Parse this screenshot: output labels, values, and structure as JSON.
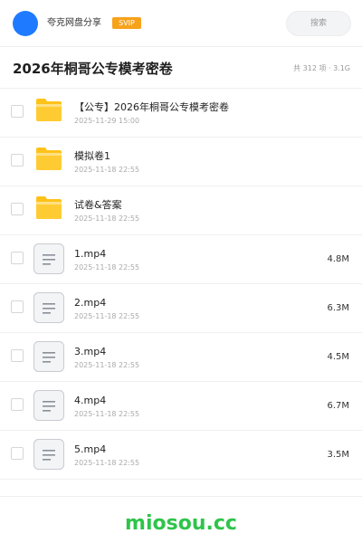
{
  "header": {
    "user_name": "夸克网盘分享",
    "badge": "SVIP",
    "search_placeholder": "搜索"
  },
  "folder": {
    "title": "2026年桐哥公专模考密卷",
    "meta": "共 312 项 · 3.1G"
  },
  "files": [
    {
      "type": "folder",
      "name": "【公专】2026年桐哥公专模考密卷",
      "date": "2025-11-29 15:00",
      "size": ""
    },
    {
      "type": "folder",
      "name": "模拟卷1",
      "date": "2025-11-18 22:55",
      "size": ""
    },
    {
      "type": "folder",
      "name": "试卷&答案",
      "date": "2025-11-18 22:55",
      "size": ""
    },
    {
      "type": "file",
      "name": "1.mp4",
      "date": "2025-11-18 22:55",
      "size": "4.8M"
    },
    {
      "type": "file",
      "name": "2.mp4",
      "date": "2025-11-18 22:55",
      "size": "6.3M"
    },
    {
      "type": "file",
      "name": "3.mp4",
      "date": "2025-11-18 22:55",
      "size": "4.5M"
    },
    {
      "type": "file",
      "name": "4.mp4",
      "date": "2025-11-18 22:55",
      "size": "6.7M"
    },
    {
      "type": "file",
      "name": "5.mp4",
      "date": "2025-11-18 22:55",
      "size": "3.5M"
    }
  ],
  "watermark": "miosou.cc",
  "colors": {
    "accent": "#1e7bff",
    "badge": "#f7a21b",
    "folder": "#ffc21a",
    "watermark": "#2fc44a"
  }
}
